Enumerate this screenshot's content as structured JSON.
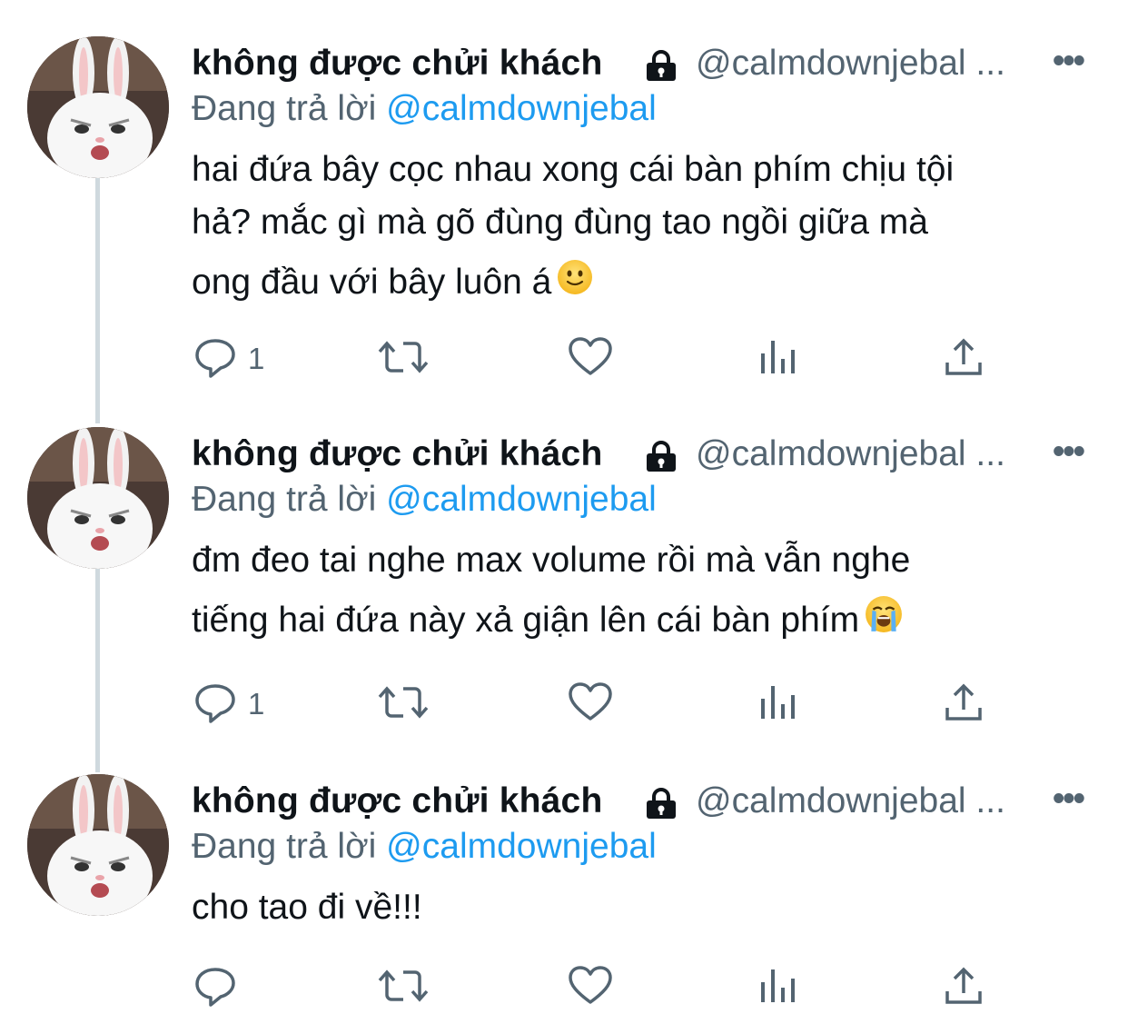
{
  "tweets": [
    {
      "author_name": "không được chửi khách",
      "handle": "@calmdownjebal ...",
      "replying_label": "Đang trả lời",
      "replying_to": "@calmdownjebal",
      "text_lines": [
        "hai đứa bây cọc nhau xong cái bàn phím chịu tội",
        "hả? mắc gì mà gõ đùng đùng tao ngồi giữa mà",
        "ong đầu với bây luôn á"
      ],
      "emoji": "slightly-smiling-face",
      "reply_count": "1",
      "retweet_count": "",
      "like_count": ""
    },
    {
      "author_name": "không được chửi khách",
      "handle": "@calmdownjebal ...",
      "replying_label": "Đang trả lời",
      "replying_to": "@calmdownjebal",
      "text_lines": [
        "đm đeo tai nghe max volume rồi mà vẫn nghe",
        "tiếng hai đứa này xả giận lên cái bàn phím"
      ],
      "emoji": "loudly-crying-face",
      "reply_count": "1",
      "retweet_count": "",
      "like_count": ""
    },
    {
      "author_name": "không được chửi khách",
      "handle": "@calmdownjebal ...",
      "replying_label": "Đang trả lời",
      "replying_to": "@calmdownjebal",
      "text_lines": [
        "cho tao đi về!!!"
      ],
      "emoji": "",
      "reply_count": "",
      "retweet_count": "",
      "like_count": ""
    }
  ],
  "more_label": "•••",
  "colors": {
    "text": "#0f1419",
    "secondary": "#536471",
    "link": "#1d9bf0",
    "thread_line": "#cfd9de"
  },
  "icons": [
    "lock-icon",
    "reply-icon",
    "retweet-icon",
    "like-icon",
    "analytics-icon",
    "share-icon"
  ]
}
